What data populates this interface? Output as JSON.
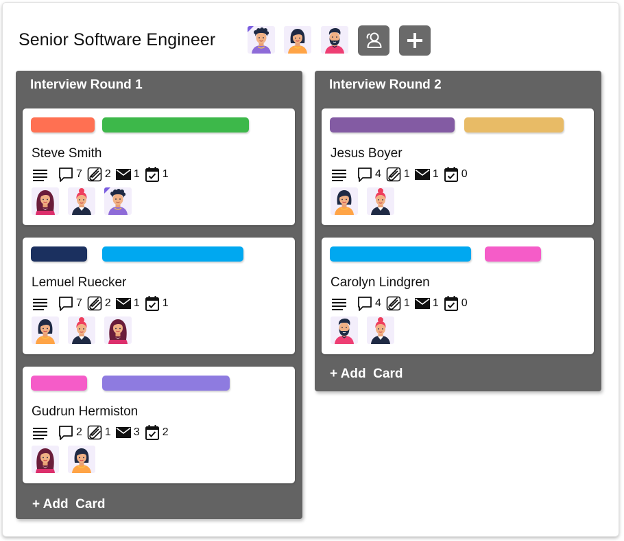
{
  "board": {
    "title": "Senior Software Engineer",
    "members": [
      "avatar-man-curly",
      "avatar-woman-bob",
      "avatar-man-beard"
    ],
    "buttons": {
      "members": "people-icon",
      "add": "plus-icon"
    }
  },
  "columns": [
    {
      "title": "Interview Round 1",
      "add_card": "+ Add  Card",
      "cards": [
        {
          "name": "Steve Smith",
          "labels": [
            "#ff7052",
            "#3db84a"
          ],
          "comments": "7",
          "attachments": "2",
          "emails": "1",
          "tasks": "1",
          "assignees": [
            "avatar-woman-long-hair",
            "avatar-woman-bun",
            "avatar-man-curly"
          ]
        },
        {
          "name": "Lemuel Ruecker",
          "labels": [
            "#1b305f",
            "#00a8f0"
          ],
          "comments": "7",
          "attachments": "2",
          "emails": "1",
          "tasks": "1",
          "assignees": [
            "avatar-woman-bob",
            "avatar-woman-bun",
            "avatar-woman-long-hair"
          ]
        },
        {
          "name": "Gudrun Hermiston",
          "labels": [
            "#f55cc8",
            "#8e7be0"
          ],
          "comments": "2",
          "attachments": "1",
          "emails": "3",
          "tasks": "2",
          "assignees": [
            "avatar-woman-long-hair",
            "avatar-woman-bob"
          ]
        }
      ]
    },
    {
      "title": "Interview Round 2",
      "add_card": "+ Add  Card",
      "cards": [
        {
          "name": "Jesus Boyer",
          "labels": [
            "#835ba3",
            "#e8bb66"
          ],
          "comments": "4",
          "attachments": "1",
          "emails": "1",
          "tasks": "0",
          "assignees": [
            "avatar-woman-bob",
            "avatar-woman-bun"
          ]
        },
        {
          "name": "Carolyn Lindgren",
          "labels": [
            "#00a8f0",
            "#f55cc8"
          ],
          "comments": "4",
          "attachments": "1",
          "emails": "1",
          "tasks": "0",
          "assignees": [
            "avatar-man-beard",
            "avatar-woman-bun"
          ]
        }
      ]
    }
  ]
}
